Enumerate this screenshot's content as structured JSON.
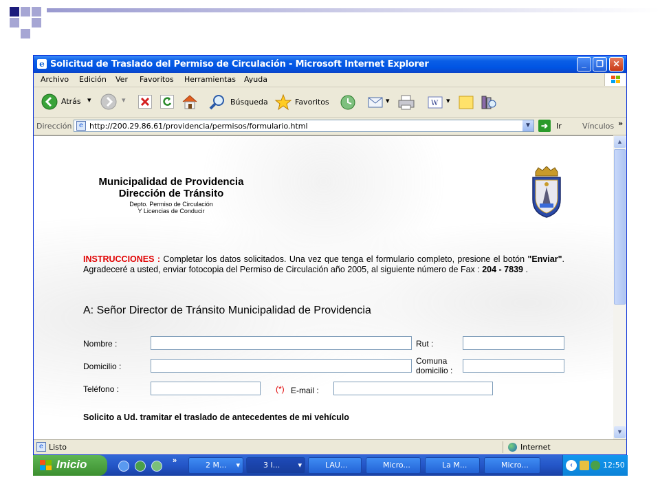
{
  "window": {
    "title": "Solicitud de Traslado del Permiso de Circulación - Microsoft Internet Explorer"
  },
  "menu": [
    "Archivo",
    "Edición",
    "Ver",
    "Favoritos",
    "Herramientas",
    "Ayuda"
  ],
  "toolbar": {
    "back_label": "Atrás",
    "search_label": "Búsqueda",
    "favorites_label": "Favoritos"
  },
  "address": {
    "label": "Dirección",
    "url": "http://200.29.86.61/providencia/permisos/formulario.html",
    "go_label": "Ir",
    "links_label": "Vínculos"
  },
  "page": {
    "header_line1": "Municipalidad de Providencia",
    "header_line2": "Dirección de Tránsito",
    "header_line3": "Depto. Permiso de Circulación",
    "header_line4": "Y Licencias de Conducir",
    "instr_label": "INSTRUCCIONES :",
    "instr_text_a": " Completar los datos solicitados. Una vez que tenga el formulario completo, presione el botón ",
    "instr_enviar": "\"Enviar\"",
    "instr_text_b": ". Agradeceré a usted, enviar fotocopia del Permiso de Circulación año 2005, al siguiente número de Fax : ",
    "instr_fax": "204 - 7839",
    "instr_text_c": " .",
    "addressee": "A: Señor Director de Tránsito Municipalidad de Providencia",
    "label_nombre": "Nombre :",
    "label_rut": "Rut :",
    "label_domicilio": "Domicilio :",
    "label_comuna_1": "Comuna",
    "label_comuna_2": "domicilio :",
    "label_telefono": "Teléfono :",
    "required_mark": "(*)",
    "label_email": "E-mail :",
    "request_text": "Solicito a Ud. tramitar el traslado de antecedentes de mi vehículo"
  },
  "status": {
    "text": "Listo",
    "zone": "Internet"
  },
  "taskbar": {
    "start_label": "Inicio",
    "items": [
      "2 M...",
      "3 I...",
      "LAU...",
      "Micro...",
      "La M...",
      "Micro..."
    ],
    "clock": "12:50"
  },
  "colors": {
    "titlebar": "#0054e3",
    "instructions_red": "#e00000",
    "taskbar_blue": "#2456c8",
    "start_green": "#3c8f2f"
  }
}
